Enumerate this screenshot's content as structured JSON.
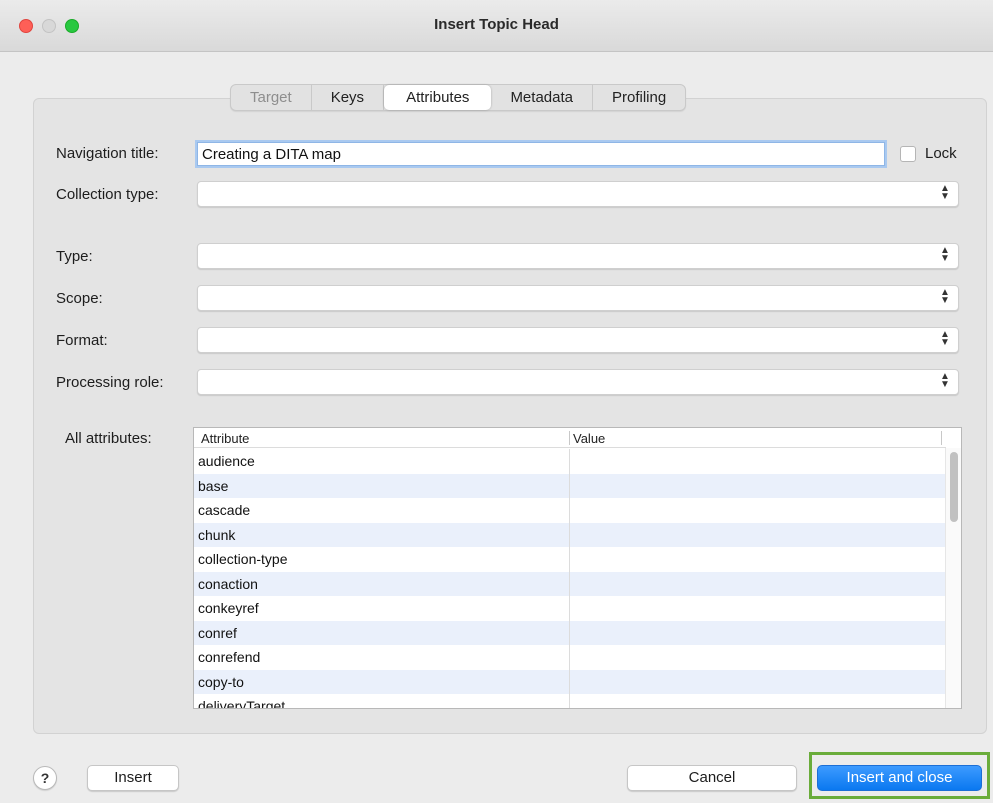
{
  "window": {
    "title": "Insert Topic Head"
  },
  "tabs": [
    {
      "label": "Target",
      "state": "disabled"
    },
    {
      "label": "Keys",
      "state": "normal"
    },
    {
      "label": "Attributes",
      "state": "active"
    },
    {
      "label": "Metadata",
      "state": "normal"
    },
    {
      "label": "Profiling",
      "state": "normal"
    }
  ],
  "form": {
    "navigation_title": {
      "label": "Navigation title:",
      "value": "Creating a DITA map"
    },
    "lock_label": "Lock",
    "collection_type": {
      "label": "Collection type:",
      "value": ""
    },
    "type": {
      "label": "Type:",
      "value": ""
    },
    "scope": {
      "label": "Scope:",
      "value": ""
    },
    "format": {
      "label": "Format:",
      "value": ""
    },
    "processing_role": {
      "label": "Processing role:",
      "value": ""
    },
    "all_attributes_label": "All attributes:"
  },
  "attributes_table": {
    "headers": [
      "Attribute",
      "Value"
    ],
    "rows": [
      {
        "attribute": "audience",
        "value": ""
      },
      {
        "attribute": "base",
        "value": ""
      },
      {
        "attribute": "cascade",
        "value": ""
      },
      {
        "attribute": "chunk",
        "value": ""
      },
      {
        "attribute": "collection-type",
        "value": ""
      },
      {
        "attribute": "conaction",
        "value": ""
      },
      {
        "attribute": "conkeyref",
        "value": ""
      },
      {
        "attribute": "conref",
        "value": ""
      },
      {
        "attribute": "conrefend",
        "value": ""
      },
      {
        "attribute": "copy-to",
        "value": ""
      },
      {
        "attribute": "deliveryTarget",
        "value": ""
      }
    ]
  },
  "buttons": {
    "help": "?",
    "insert": "Insert",
    "cancel": "Cancel",
    "insert_and_close": "Insert and close"
  },
  "colors": {
    "primary_button": "#0a78f0",
    "highlight_border": "#6aac3a",
    "row_alt": "#eaf0fb"
  }
}
